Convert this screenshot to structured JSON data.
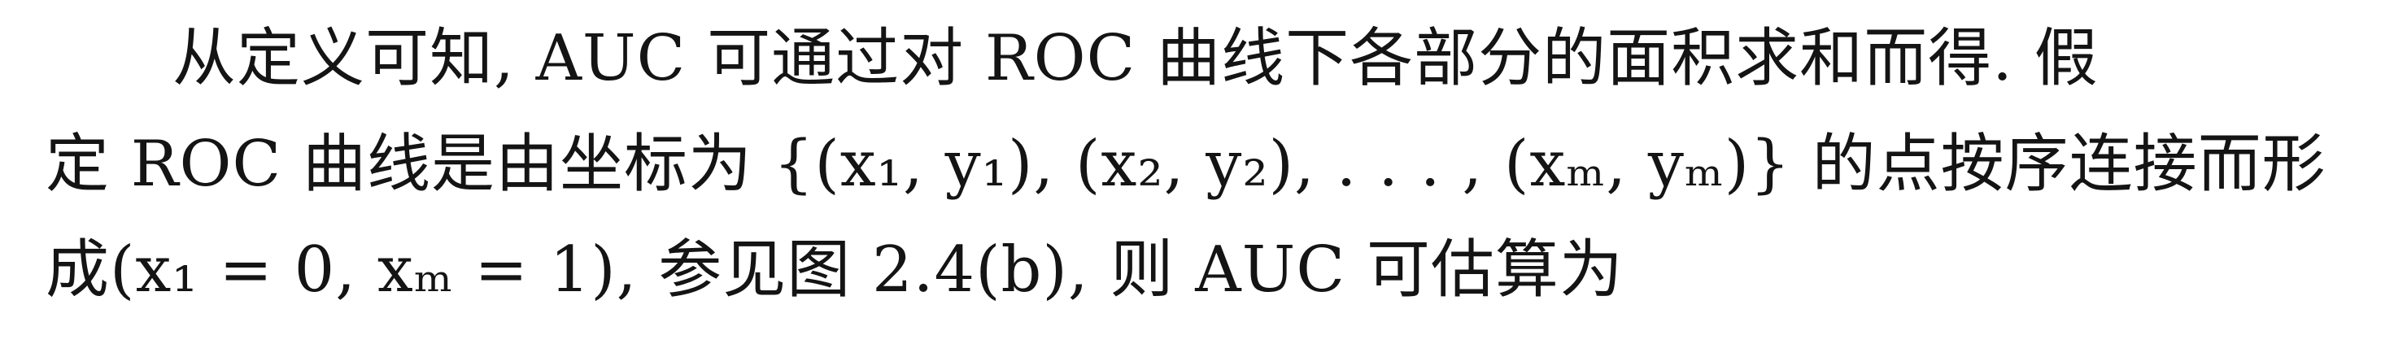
{
  "paragraph": {
    "lines": [
      "从定义可知, AUC 可通过对 ROC 曲线下各部分的面积求和而得.  假",
      "定 ROC 曲线是由坐标为 {(x₁, y₁), (x₂, y₂), . . . , (xₘ, yₘ)} 的点按序连接而形",
      "成(x₁ = 0, xₘ = 1), 参见图 2.4(b), 则 AUC 可估算为"
    ]
  }
}
